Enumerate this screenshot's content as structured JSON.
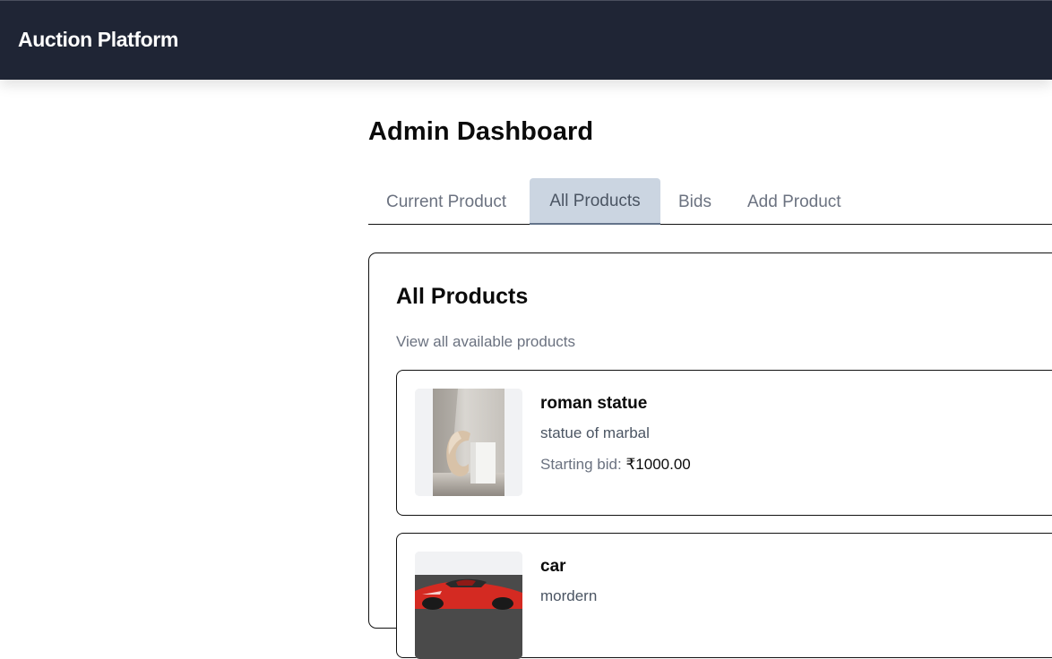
{
  "header": {
    "brand": "Auction Platform"
  },
  "page": {
    "title": "Admin Dashboard"
  },
  "tabs": [
    {
      "label": "Current Product",
      "active": false
    },
    {
      "label": "All Products",
      "active": true
    },
    {
      "label": "Bids",
      "active": false
    },
    {
      "label": "Add Product",
      "active": false
    }
  ],
  "card": {
    "title": "All Products",
    "subtitle": "View all available products"
  },
  "products": [
    {
      "name": "roman statue",
      "description": "statue of marbal",
      "bid_label": "Starting bid:",
      "bid_amount": "₹1000.00",
      "image": "vase-sculpture-photo"
    },
    {
      "name": "car",
      "description": "mordern",
      "image": "red-car-photo"
    }
  ],
  "colors": {
    "header_bg": "#1f2535",
    "active_tab_bg": "#cbd5e1",
    "muted_text": "#6b7280"
  }
}
